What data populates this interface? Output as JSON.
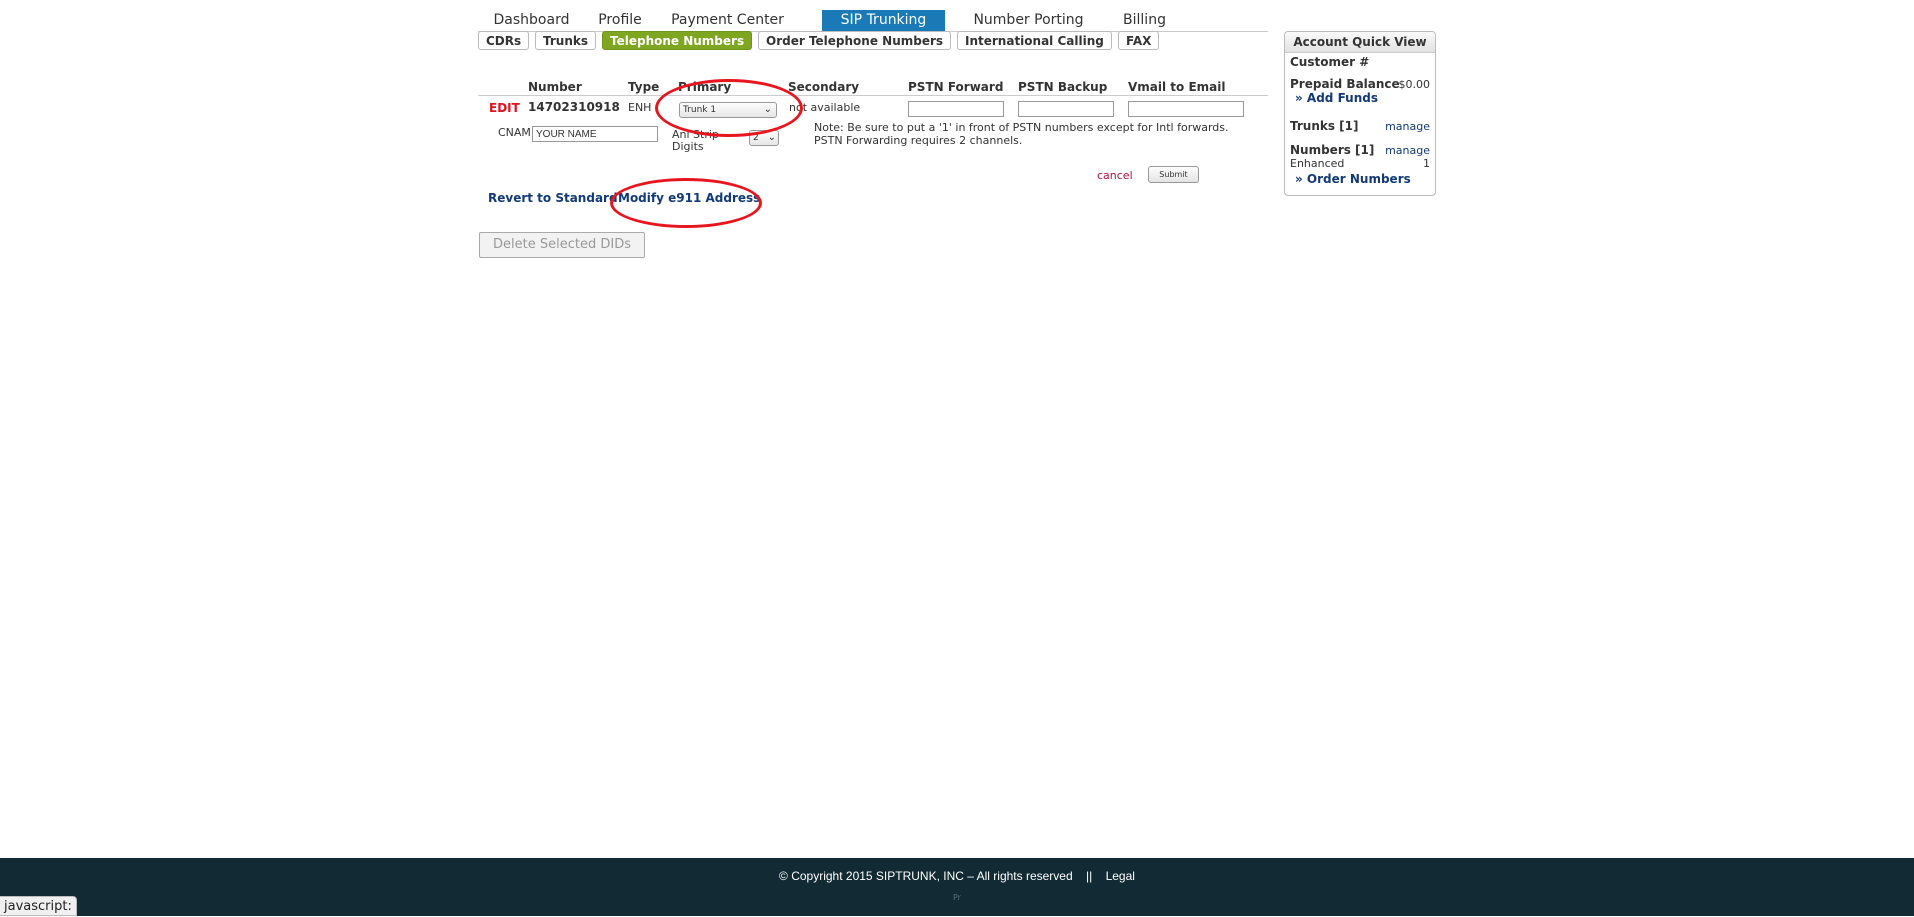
{
  "nav": {
    "tabs": [
      "Dashboard",
      "Profile",
      "Payment Center",
      "SIP Trunking",
      "Number Porting",
      "Billing"
    ],
    "active": "SIP Trunking"
  },
  "subnav": {
    "tabs": [
      "CDRs",
      "Trunks",
      "Telephone Numbers",
      "Order Telephone Numbers",
      "International Calling",
      "FAX"
    ],
    "active": "Telephone Numbers"
  },
  "table": {
    "headers": [
      "Number",
      "Type",
      "Primary",
      "Secondary",
      "PSTN Forward",
      "PSTN Backup",
      "Vmail to Email"
    ],
    "row": {
      "edit_label": "EDIT",
      "number": "14702310918",
      "type": "ENH",
      "primary_selected": "Trunk 1",
      "secondary": "not available",
      "pstn_forward": "",
      "pstn_backup": "",
      "vmail_to_email": ""
    },
    "cnam_label": "CNAM",
    "cnam_value": "YOUR NAME",
    "ani_strip_label": "Ani Strip Digits",
    "ani_strip_value": "2",
    "note": "Note: Be sure to put a '1' in front of PSTN numbers except for Intl forwards. PSTN Forwarding requires 2 channels.",
    "cancel_label": "cancel",
    "submit_label": "Submit"
  },
  "actions": {
    "revert_label": "Revert to Standard",
    "modify_e911_label": "Modify e911 Address",
    "delete_label": "Delete Selected DIDs"
  },
  "quick_view": {
    "title": "Account Quick View",
    "customer_label": "Customer #",
    "prepaid_label": "Prepaid Balance",
    "prepaid_value": "$0.00",
    "add_funds_label": "» Add Funds",
    "trunks_label": "Trunks [1]",
    "trunks_manage": "manage",
    "numbers_label": "Numbers [1]",
    "numbers_manage": "manage",
    "enhanced_label": "Enhanced",
    "enhanced_value": "1",
    "order_numbers_label": "» Order Numbers"
  },
  "footer": {
    "copyright": "© Copyright 2015 SIPTRUNK, INC – All rights reserved",
    "separator": "||",
    "legal_label": "Legal",
    "tiny": "Pr"
  },
  "statusbar": {
    "text": "javascript:"
  },
  "colors": {
    "active_tab": "#1a7ab8",
    "active_subtab": "#7ea620",
    "edit_red": "#e0121a",
    "link_blue": "#123a78",
    "annotation_red": "#e8141e",
    "footer_bg": "#112a33"
  }
}
